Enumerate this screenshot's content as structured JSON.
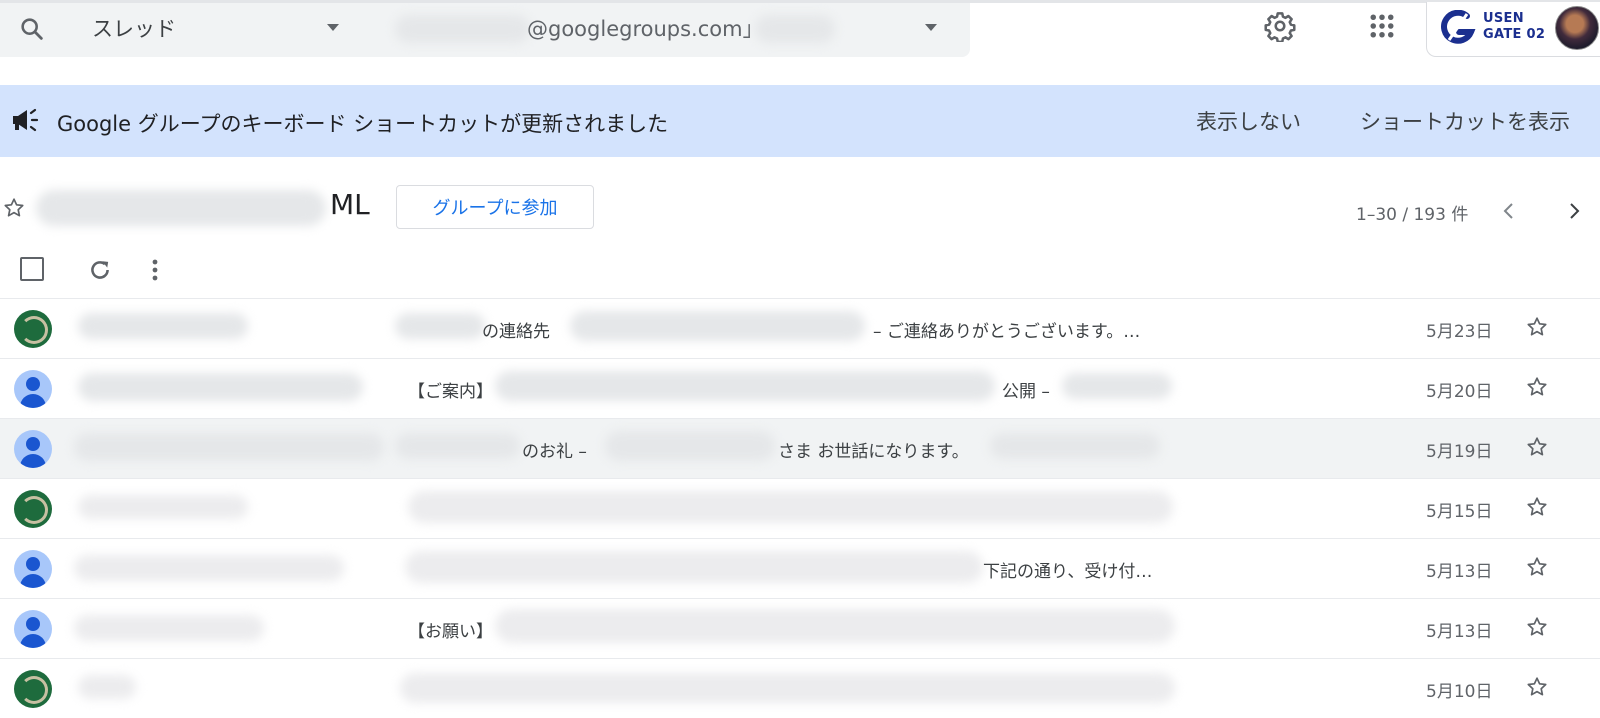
{
  "search": {
    "scope": "スレッド",
    "query_visible": "@googlegroups.com」"
  },
  "brand": {
    "line1": "USEN",
    "line2": "GATE 02"
  },
  "banner": {
    "message": "Google グループのキーボード ショートカットが更新されました",
    "dismiss": "表示しない",
    "show": "ショートカットを表示"
  },
  "group": {
    "title_suffix": "ML",
    "join_label": "グループに参加",
    "range": "1–30 / 193 件"
  },
  "threads": [
    {
      "snippet_a": "の連絡先",
      "snippet_b": "– ご連絡ありがとうございます。…",
      "date": "5月23日",
      "avatar": "green"
    },
    {
      "snippet_a": "【ご案内】",
      "snippet_b": "公開 –",
      "date": "5月20日",
      "avatar": "person"
    },
    {
      "snippet_a": "のお礼 –",
      "snippet_b": "さま お世話になります。",
      "date": "5月19日",
      "avatar": "person"
    },
    {
      "snippet_a": "",
      "snippet_b": "",
      "date": "5月15日",
      "avatar": "green"
    },
    {
      "snippet_a": "",
      "snippet_b": "下記の通り、受け付…",
      "date": "5月13日",
      "avatar": "person"
    },
    {
      "snippet_a": "【お願い】",
      "snippet_b": "",
      "date": "5月13日",
      "avatar": "person"
    },
    {
      "snippet_a": "",
      "snippet_b": "",
      "date": "5月10日",
      "avatar": "green"
    }
  ],
  "colors": {
    "banner_bg": "#d3e3fd",
    "accent": "#1a73e8",
    "brand": "#1b2f8f"
  }
}
